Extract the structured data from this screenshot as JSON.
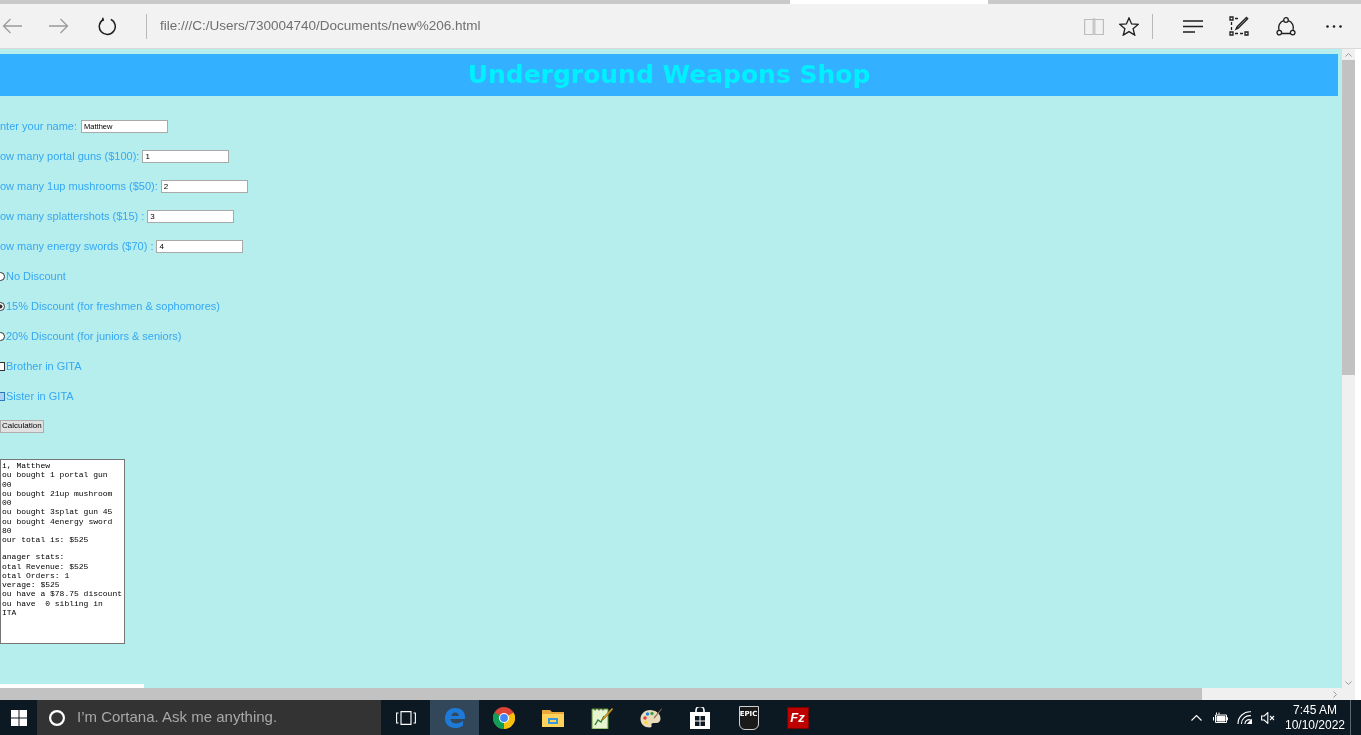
{
  "browser": {
    "nav_buttons": [
      {
        "kind": "back",
        "disabled": true
      },
      {
        "kind": "forward",
        "disabled": true
      },
      {
        "kind": "refresh",
        "disabled": false
      }
    ],
    "address": "file:///C:/Users/730004740/Documents/new%206.html",
    "tool_buttons": [
      {
        "kind": "reading-view",
        "disabled": true
      },
      {
        "kind": "favorite",
        "disabled": false
      },
      {
        "kind": "hub",
        "disabled": false
      },
      {
        "kind": "web-note",
        "disabled": false
      },
      {
        "kind": "share",
        "disabled": false
      },
      {
        "kind": "more",
        "disabled": false
      }
    ]
  },
  "page": {
    "title": "Underground Weapons Shop",
    "name_field": {
      "label": "nter your name:",
      "value": "Matthew"
    },
    "quantity_fields": [
      {
        "label": "ow many portal guns ($100):",
        "value": "1"
      },
      {
        "label": "ow many 1up mushrooms ($50):",
        "value": "2"
      },
      {
        "label": "ow many splattershots ($15) :",
        "value": "3"
      },
      {
        "label": "ow many energy swords ($70) :",
        "value": "4"
      }
    ],
    "discounts": [
      {
        "label": "No Discount",
        "selected": false
      },
      {
        "label": "15% Discount (for freshmen & sophomores)",
        "selected": true
      },
      {
        "label": "20% Discount (for juniors & seniors)",
        "selected": false
      }
    ],
    "siblings": [
      {
        "label": "Brother in GITA",
        "checked": false,
        "hover": false
      },
      {
        "label": "Sister in GITA",
        "checked": false,
        "hover": true
      }
    ],
    "submit_button": "Calculation",
    "output": {
      "blocks": [
        {
          "lines": [
            "i, Matthew",
            "ou bought 1 portal gun",
            "00",
            "ou bought 21up mushroom",
            "00",
            "ou bought 3splat gun 45",
            "ou bought 4energy sword",
            "80",
            "our total is: $525"
          ]
        },
        {
          "lines": [
            "anager stats:",
            "otal Revenue: $525",
            "otal Orders: 1",
            "verage: $525",
            "ou have a $78.75 discount",
            "ou have  0 sibling in",
            "ITA"
          ]
        }
      ]
    }
  },
  "taskbar": {
    "search": {
      "placeholder": "I’m Cortana. Ask me anything."
    },
    "apps": [
      {
        "kind": "edge",
        "selected": true
      },
      {
        "kind": "chrome",
        "selected": false
      },
      {
        "kind": "explorer",
        "selected": false
      },
      {
        "kind": "notes",
        "selected": false
      },
      {
        "kind": "paint",
        "selected": false
      },
      {
        "kind": "store",
        "selected": false
      },
      {
        "kind": "epic",
        "selected": false,
        "logo_text": "EPIC"
      },
      {
        "kind": "filezilla",
        "selected": false,
        "logo_text": "Fz"
      }
    ],
    "clock": {
      "time": "7:45 AM",
      "date": "10/10/2022"
    }
  }
}
